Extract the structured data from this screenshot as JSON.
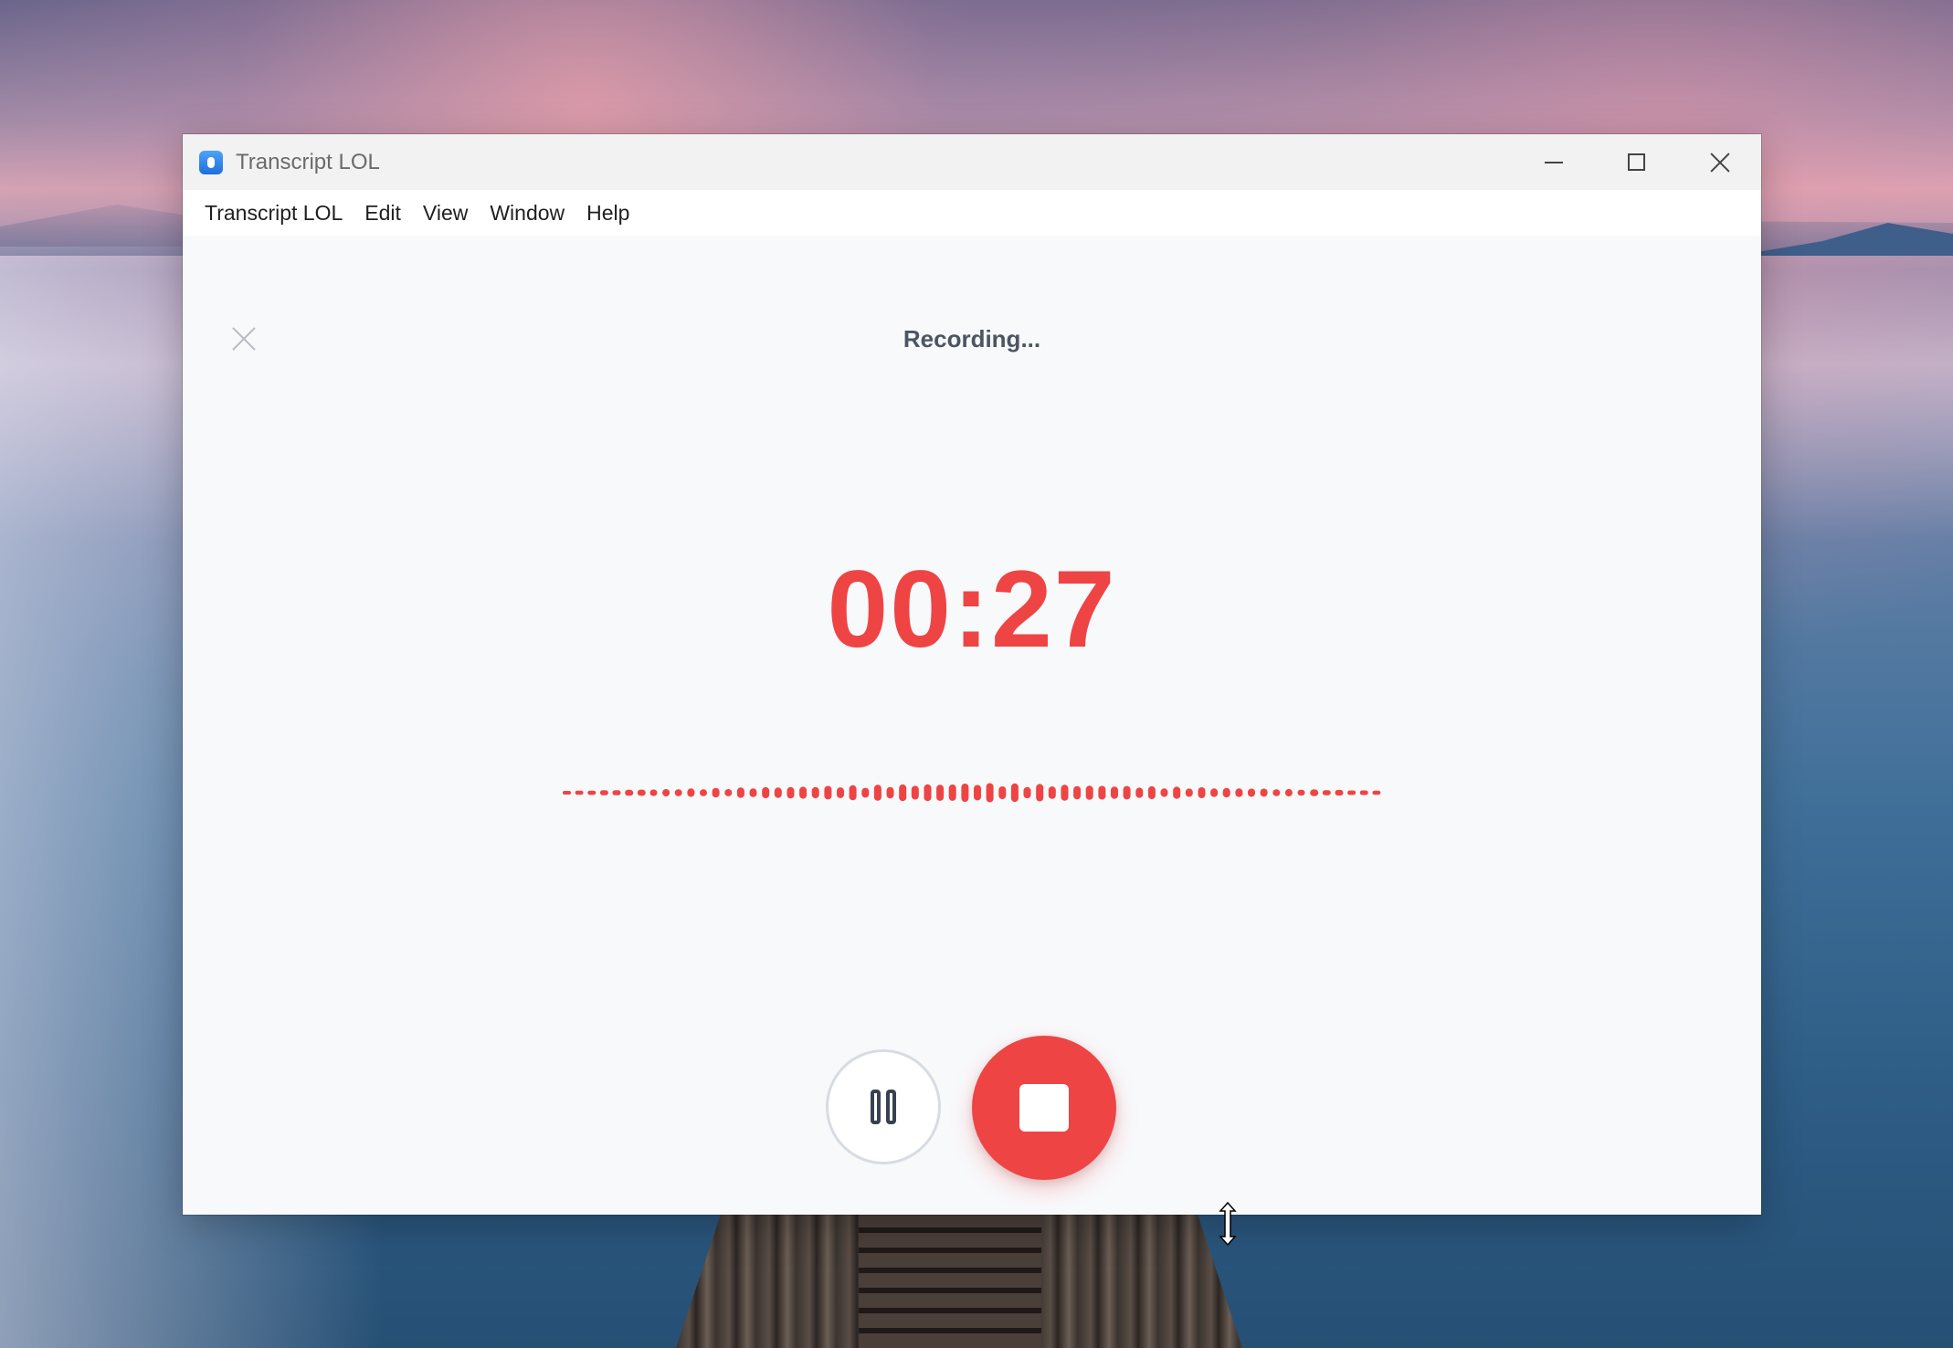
{
  "window": {
    "title": "Transcript LOL"
  },
  "menubar": {
    "items": [
      "Transcript LOL",
      "Edit",
      "View",
      "Window",
      "Help"
    ]
  },
  "recorder": {
    "status": "Recording...",
    "timer": "00:27",
    "state": "recording"
  },
  "icons": {
    "app": "microphone-app-icon",
    "minimize": "minimize-icon",
    "maximize": "maximize-icon",
    "close": "close-icon",
    "dismiss": "dismiss-x-icon",
    "pause": "pause-icon",
    "stop": "stop-icon"
  },
  "colors": {
    "accent": "#ef4444",
    "text_secondary": "#4b5563",
    "window_bg": "#f8f9fb"
  }
}
